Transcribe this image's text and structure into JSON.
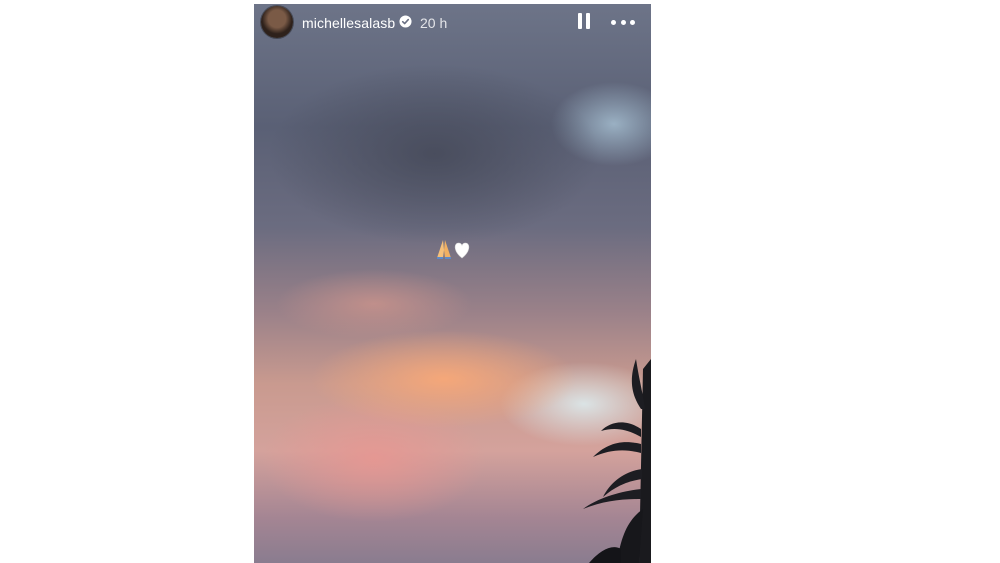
{
  "story": {
    "username": "michellesalasb",
    "time": "20 h",
    "sticker_emojis": [
      "folded-hands-emoji",
      "white-heart-emoji"
    ],
    "icons": {
      "verified": "verified-badge-icon",
      "pause": "pause-icon",
      "more": "more-options-icon"
    }
  }
}
